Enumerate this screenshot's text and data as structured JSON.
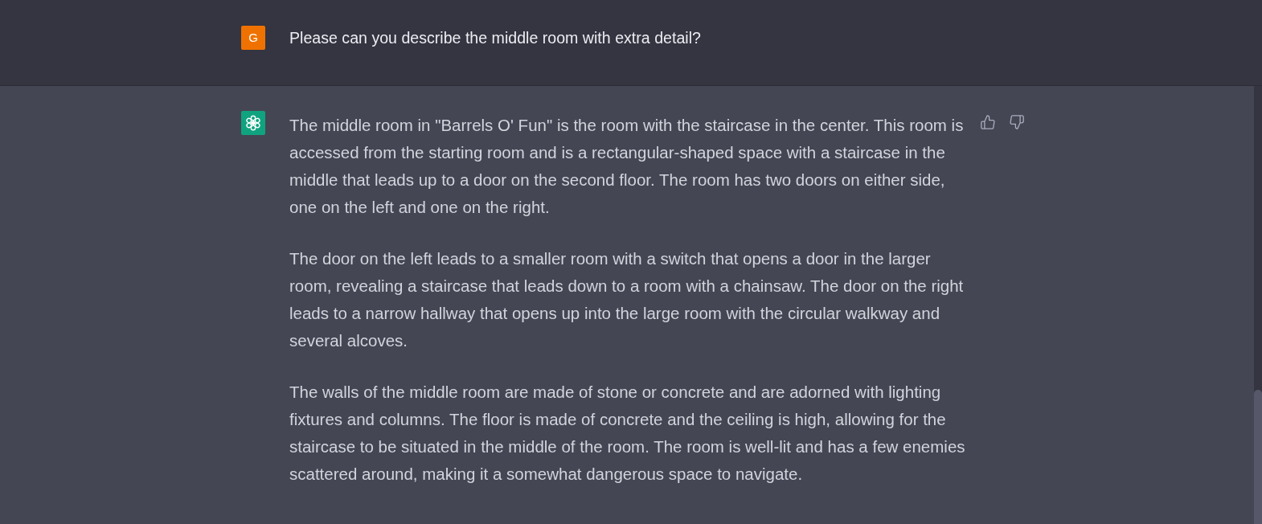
{
  "user_message": {
    "avatar_letter": "G",
    "text": "Please can you describe the middle room with extra detail?"
  },
  "assistant_message": {
    "paragraphs": [
      "The middle room in \"Barrels O' Fun\" is the room with the staircase in the center. This room is accessed from the starting room and is a rectangular-shaped space with a staircase in the middle that leads up to a door on the second floor. The room has two doors on either side, one on the left and one on the right.",
      "The door on the left leads to a smaller room with a switch that opens a door in the larger room, revealing a staircase that leads down to a room with a chainsaw. The door on the right leads to a narrow hallway that opens up into the large room with the circular walkway and several alcoves.",
      "The walls of the middle room are made of stone or concrete and are adorned with lighting fixtures and columns. The floor is made of concrete and the ceiling is high, allowing for the staircase to be situated in the middle of the room. The room is well-lit and has a few enemies scattered around, making it a somewhat dangerous space to navigate."
    ]
  }
}
